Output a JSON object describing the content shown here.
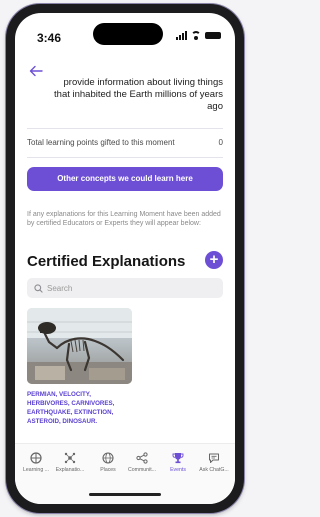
{
  "status_bar": {
    "time": "3:46"
  },
  "moment": {
    "intro_text": "provide information about living things that inhabited the Earth millions of years ago",
    "points_label": "Total learning points gifted to this moment",
    "points_value": "0"
  },
  "concepts_button_label": "Other concepts we could learn here",
  "explanations_info": "If any explanations for this Learning Moment have been added by certified Educators or Experts they will appear below:",
  "section_title": "Certified Explanations",
  "add_button_label": "+",
  "search": {
    "placeholder": "Search"
  },
  "explanation_card": {
    "tags": "PERMIAN, VELOCITY, HERBIVORES, CARNIVORES, EARTHQUAKE, EXTINCTION, ASTEROID, DINOSAUR."
  },
  "tabs": [
    {
      "label": "Learning ...",
      "icon": "learning-icon",
      "active": false
    },
    {
      "label": "Explanatio...",
      "icon": "explanations-icon",
      "active": false
    },
    {
      "label": "Places",
      "icon": "globe-icon",
      "active": false
    },
    {
      "label": "Communit...",
      "icon": "share-icon",
      "active": false
    },
    {
      "label": "Events",
      "icon": "trophy-icon",
      "active": true
    },
    {
      "label": "Ask ChatG...",
      "icon": "chat-icon",
      "active": false
    }
  ],
  "colors": {
    "accent": "#6d4fd6",
    "tag_text": "#5a3fd0",
    "phone_frame": "#1c1c1e"
  }
}
